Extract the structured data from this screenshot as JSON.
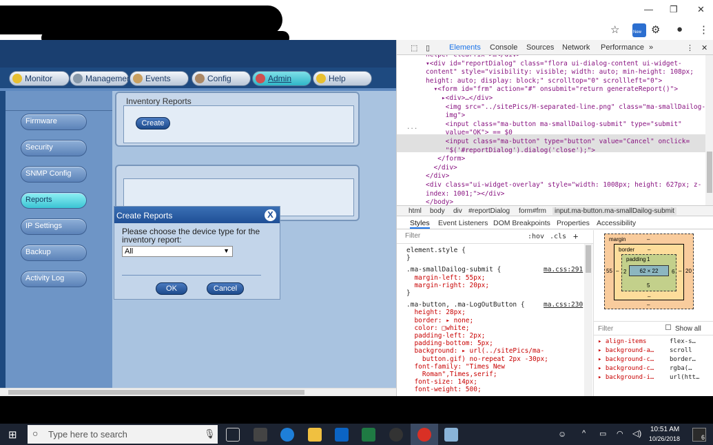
{
  "browser": {
    "new_badge": "New",
    "window_controls": [
      "—",
      "❐",
      "✕"
    ]
  },
  "app": {
    "nav": [
      {
        "label": "Monitor",
        "active": false
      },
      {
        "label": "Management",
        "active": false
      },
      {
        "label": "Events",
        "active": false
      },
      {
        "label": "Config",
        "active": false
      },
      {
        "label": "Admin",
        "active": true
      },
      {
        "label": "Help",
        "active": false
      }
    ],
    "sidebar": [
      {
        "label": "Firmware",
        "active": false
      },
      {
        "label": "Security",
        "active": false
      },
      {
        "label": "SNMP Config",
        "active": false
      },
      {
        "label": "Reports",
        "active": true
      },
      {
        "label": "IP Settings",
        "active": false
      },
      {
        "label": "Backup",
        "active": false
      },
      {
        "label": "Activity Log",
        "active": false
      }
    ],
    "inventory_panel": {
      "title": "Inventory Reports",
      "create_label": "Create"
    },
    "dialog": {
      "title": "Create Reports",
      "close_glyph": "X",
      "prompt": "Please choose the device type for the inventory report:",
      "select_value": "All",
      "ok_label": "OK",
      "cancel_label": "Cancel"
    }
  },
  "devtools": {
    "tabs": [
      "Elements",
      "Console",
      "Sources",
      "Network",
      "Performance",
      "»"
    ],
    "code_lines": [
      "helper-clearfix\">…</div>",
      "▾<div id=\"reportDialog\" class=\"flora ui-dialog-content ui-widget-",
      "content\" style=\"visibility: visible; width: auto; min-height: 108px;",
      "height: auto; display: block;\" scrolltop=\"0\" scrollleft=\"0\">",
      "  ▾<form id=\"frm\" action=\"#\" onsubmit=\"return generateReport()\">",
      "    ▸<div>…</div>",
      "     <img src=\"../sitePics/H-separated-line.png\" class=\"ma-smallDailog-",
      "     img\">",
      "     <input class=\"ma-button ma-smallDailog-submit\" type=\"submit\"",
      "     value=\"OK\"> == $0",
      "     <input class=\"ma-button\" type=\"button\" value=\"Cancel\" onclick=",
      "     \"$('#reportDialog').dialog('close');\">",
      "   </form>",
      "  </div>",
      "</div>",
      "<div class=\"ui-widget-overlay\" style=\"width: 1008px; height: 627px; z-",
      "index: 1001;\"></div>",
      "</body>"
    ],
    "breadcrumbs": [
      "html",
      "body",
      "div",
      "#reportDialog",
      "form#frm",
      "input.ma-button.ma-smallDailog-submit"
    ],
    "subtabs": [
      "Styles",
      "Event Listeners",
      "DOM Breakpoints",
      "Properties",
      "Accessibility"
    ],
    "filter_placeholder": "Filter",
    "hov": ":hov",
    "cls": ".cls",
    "plus": "+",
    "style_lines": [
      {
        "t": "element.style {",
        "k": "sel"
      },
      {
        "t": "}",
        "k": "sel"
      },
      {
        "t": ".ma-smallDailog-submit {",
        "k": "sel",
        "src": "ma.css:291"
      },
      {
        "t": "  margin-left: 55px;",
        "k": "prop"
      },
      {
        "t": "  margin-right: 20px;",
        "k": "prop"
      },
      {
        "t": "}",
        "k": "sel"
      },
      {
        "t": ".ma-button, .ma-LogOutButton {",
        "k": "sel",
        "src": "ma.css:230"
      },
      {
        "t": "  height: 28px;",
        "k": "prop"
      },
      {
        "t": "  border: ▸ none;",
        "k": "prop"
      },
      {
        "t": "  color: □white;",
        "k": "prop"
      },
      {
        "t": "  padding-left: 2px;",
        "k": "prop"
      },
      {
        "t": "  padding-bottom: 5px;",
        "k": "prop"
      },
      {
        "t": "  background: ▸ url(../sitePics/ma-",
        "k": "prop"
      },
      {
        "t": "    button.gif) no-repeat 2px -30px;",
        "k": "prop"
      },
      {
        "t": "  font-family: \"Times New",
        "k": "prop"
      },
      {
        "t": "    Roman\",Times,serif;",
        "k": "prop"
      },
      {
        "t": "  font-size: 14px;",
        "k": "prop"
      },
      {
        "t": "  font-weight: 500;",
        "k": "prop"
      }
    ],
    "boxmodel": {
      "margin_label": "margin",
      "margin_top": "–",
      "margin_left": "55",
      "margin_right": "20",
      "margin_bottom": "–",
      "border_label": "border",
      "border_top": "–",
      "border_left": "–",
      "border_right": "–",
      "border_bottom": "–",
      "padding_label": "padding",
      "padding_top": "1",
      "padding_left": "2",
      "padding_right": "6",
      "padding_bottom": "5",
      "content": "62 × 22"
    },
    "computed_filter": "Filter",
    "show_all": "Show all",
    "computed": [
      {
        "name": "align-items",
        "value": "flex-s…"
      },
      {
        "name": "background-a…",
        "value": "scroll"
      },
      {
        "name": "background-c…",
        "value": "border…"
      },
      {
        "name": "background-c…",
        "value": "rgba(…"
      },
      {
        "name": "background-i…",
        "value": "url(htt…"
      }
    ]
  },
  "taskbar": {
    "search_placeholder": "Type here to search",
    "time": "10:51 AM",
    "date": "10/26/2018",
    "notifications": "6"
  }
}
